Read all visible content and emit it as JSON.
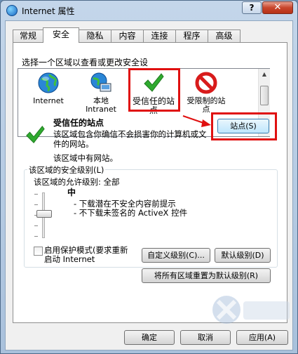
{
  "window": {
    "title": "Internet 属性",
    "help_label": "?",
    "close_label": "✕"
  },
  "tabs": [
    "常规",
    "安全",
    "隐私",
    "内容",
    "连接",
    "程序",
    "高级"
  ],
  "security": {
    "zone_prompt": "选择一个区域以查看或更改安全设",
    "zones": [
      {
        "label": "Internet",
        "icon": "globe-icon"
      },
      {
        "label": "本地\nIntranet",
        "icon": "intranet-icon"
      },
      {
        "label": "受信任的站\n点",
        "icon": "green-check-icon"
      },
      {
        "label": "受限制的站\n点",
        "icon": "restricted-icon"
      }
    ],
    "selected_zone_title": "受信任的站点",
    "zone_desc": "该区域包含你确信不会损害你的计算机或文\n件的网站。",
    "zone_has_sites": "该区域中有网站。",
    "sites_button": "站点(S)",
    "level_group_title": "该区域的安全级别(L)",
    "allowed_levels": "该区域的允许级别: 全部",
    "level_name": "中",
    "level_bullets": [
      "- 下载潜在不安全内容前提示",
      "- 不下载未签名的 ActiveX 控件"
    ],
    "protected_mode_label": "启用保护模式(要求重新\n启动 Internet",
    "protected_mode_checked": false,
    "custom_level_button": "自定义级别(C)...",
    "default_level_button": "默认级别(D)",
    "reset_all_button": "将所有区域重置为默认级别(R)"
  },
  "footer": {
    "ok": "确定",
    "cancel": "取消",
    "apply": "应用(A)"
  },
  "colors": {
    "highlight": "#e01010",
    "accent_check": "#2faa2f",
    "restricted": "#d81b1b"
  }
}
